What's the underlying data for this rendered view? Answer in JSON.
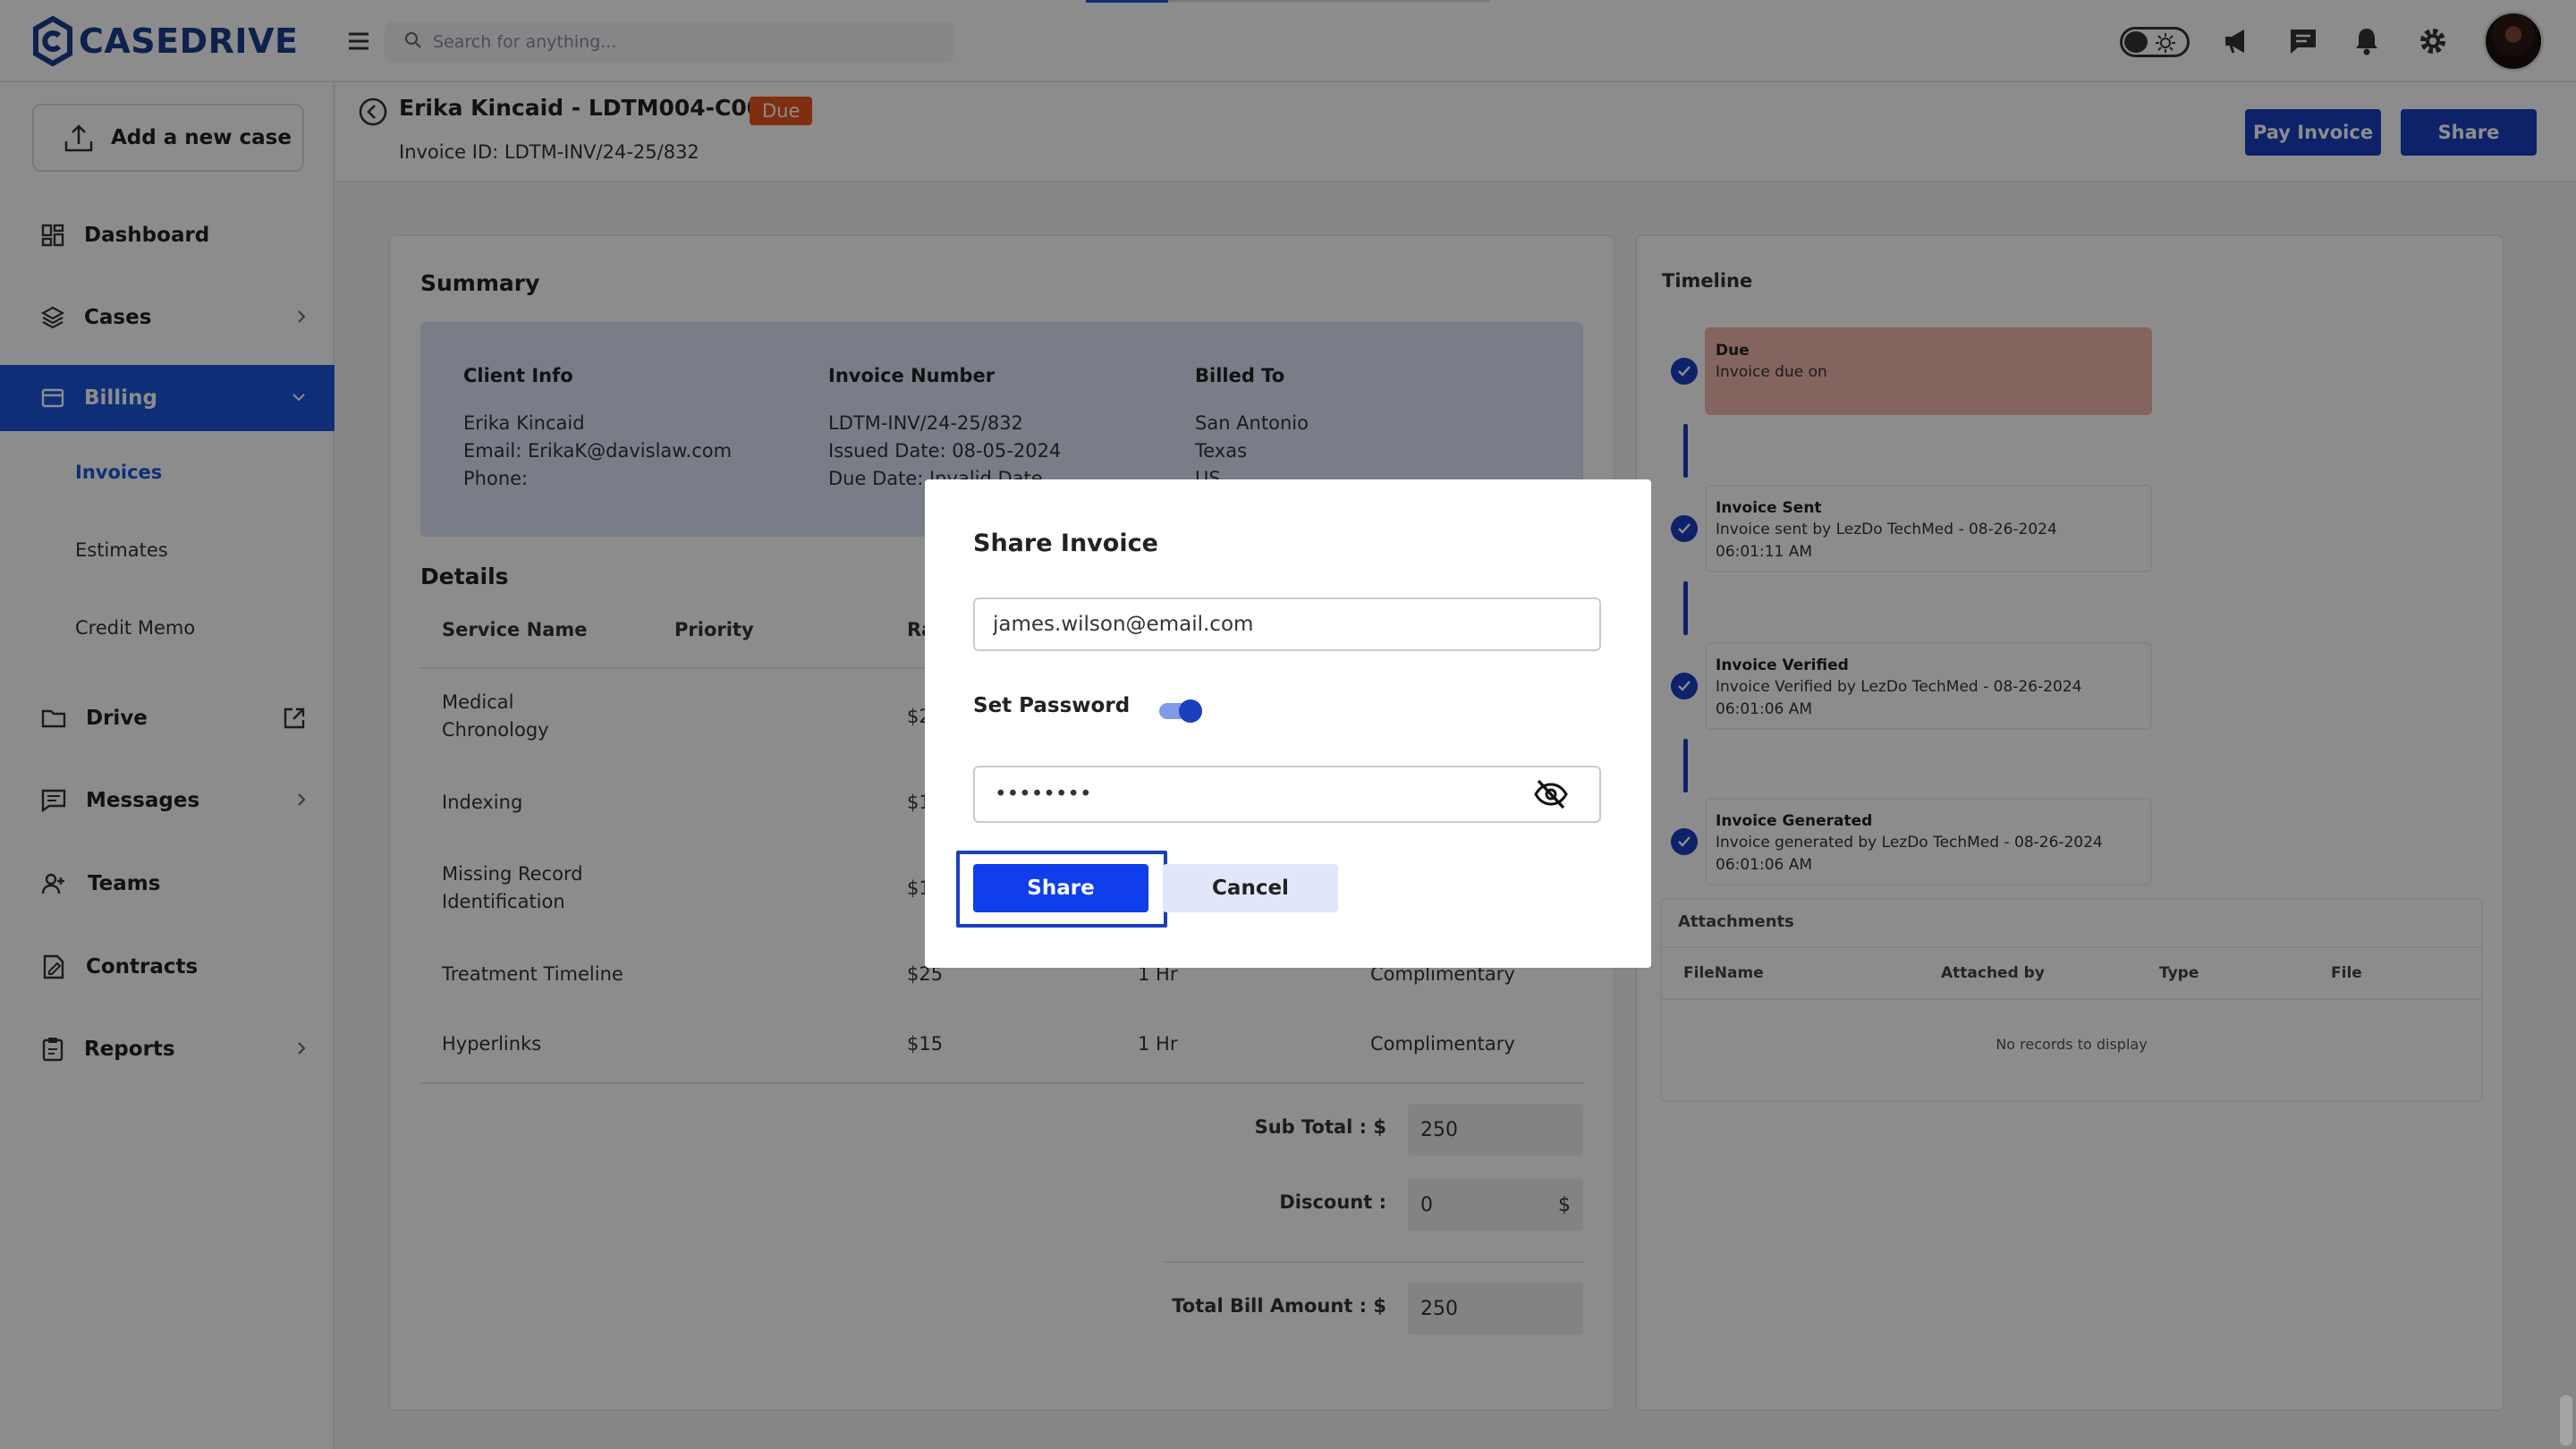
{
  "app": {
    "logo_text": "CASEDRIVE"
  },
  "topbar": {
    "search_placeholder": "Search for anything...",
    "icons": [
      "menu-icon",
      "search-icon",
      "theme-toggle-icon",
      "megaphone-icon",
      "chat-icon",
      "bell-icon",
      "gear-icon",
      "avatar"
    ]
  },
  "sidebar": {
    "add_case_label": "Add a new case",
    "items": [
      {
        "label": "Dashboard",
        "icon": "dashboard-icon"
      },
      {
        "label": "Cases",
        "icon": "layers-icon"
      },
      {
        "label": "Billing",
        "icon": "card-icon",
        "active": true
      },
      {
        "label": "Drive",
        "icon": "folder-icon"
      },
      {
        "label": "Messages",
        "icon": "message-icon"
      },
      {
        "label": "Teams",
        "icon": "users-icon"
      },
      {
        "label": "Contracts",
        "icon": "contract-icon"
      },
      {
        "label": "Reports",
        "icon": "report-icon"
      }
    ],
    "billing_sub": [
      "Invoices",
      "Estimates",
      "Credit Memo"
    ],
    "active_sub": "Invoices"
  },
  "header": {
    "case_title": "Erika Kincaid - LDTM004-C004",
    "status_badge": "Due",
    "invoice_id": "Invoice ID: LDTM-INV/24-25/832",
    "pay_label": "Pay Invoice",
    "share_label": "Share"
  },
  "summary": {
    "title": "Summary",
    "client_info": {
      "heading": "Client Info",
      "lines": [
        "Erika Kincaid",
        "Email: ErikaK@davislaw.com",
        "Phone:"
      ]
    },
    "invoice_number": {
      "heading": "Invoice Number",
      "lines": [
        "LDTM-INV/24-25/832",
        "Issued Date: 08-05-2024",
        "Due Date: Invalid Date"
      ]
    },
    "billed_to": {
      "heading": "Billed To",
      "lines": [
        "San Antonio",
        "Texas",
        "US"
      ]
    }
  },
  "details": {
    "title": "Details",
    "columns": [
      "Service Name",
      "Priority",
      "Ra"
    ],
    "rows": [
      {
        "service": [
          "Medical",
          "Chronology"
        ],
        "rate": "$2",
        "time": "",
        "type": ""
      },
      {
        "service": [
          "Indexing"
        ],
        "rate": "$1",
        "time": "",
        "type": ""
      },
      {
        "service": [
          "Missing Record",
          "Identification"
        ],
        "rate": "$1",
        "time": "",
        "type": ""
      },
      {
        "service": [
          "Treatment Timeline"
        ],
        "rate": "$25",
        "time": "1 Hr",
        "type": "Complimentary"
      },
      {
        "service": [
          "Hyperlinks"
        ],
        "rate": "$15",
        "time": "1 Hr",
        "type": "Complimentary"
      }
    ],
    "subtotal_label": "Sub Total : $",
    "subtotal_value": "250",
    "discount_label": "Discount :",
    "discount_value": "0",
    "discount_unit": "$",
    "total_label": "Total Bill Amount : $",
    "total_value": "250"
  },
  "timeline": {
    "title": "Timeline",
    "events": [
      {
        "title": "Due",
        "desc": [
          "Invoice due on"
        ]
      },
      {
        "title": "Invoice Sent",
        "desc": [
          "Invoice sent by LezDo TechMed - 08-26-2024",
          "06:01:11 AM"
        ]
      },
      {
        "title": "Invoice Verified",
        "desc": [
          "Invoice Verified by LezDo TechMed - 08-26-2024",
          "06:01:06 AM"
        ]
      },
      {
        "title": "Invoice Generated",
        "desc": [
          "Invoice generated by LezDo TechMed - 08-26-2024",
          "06:01:06 AM"
        ]
      }
    ]
  },
  "attachments": {
    "title": "Attachments",
    "columns": [
      "FileName",
      "Attached by",
      "Type",
      "File"
    ],
    "empty_text": "No records to display"
  },
  "modal": {
    "title": "Share Invoice",
    "email_value": "james.wilson@email.com",
    "set_password_label": "Set Password",
    "set_password_on": true,
    "password_value": "••••••••",
    "share_label": "Share",
    "cancel_label": "Cancel"
  },
  "colors": {
    "brand": "#1a3fc1",
    "accent": "#0f3eea",
    "due": "#e8541e"
  }
}
